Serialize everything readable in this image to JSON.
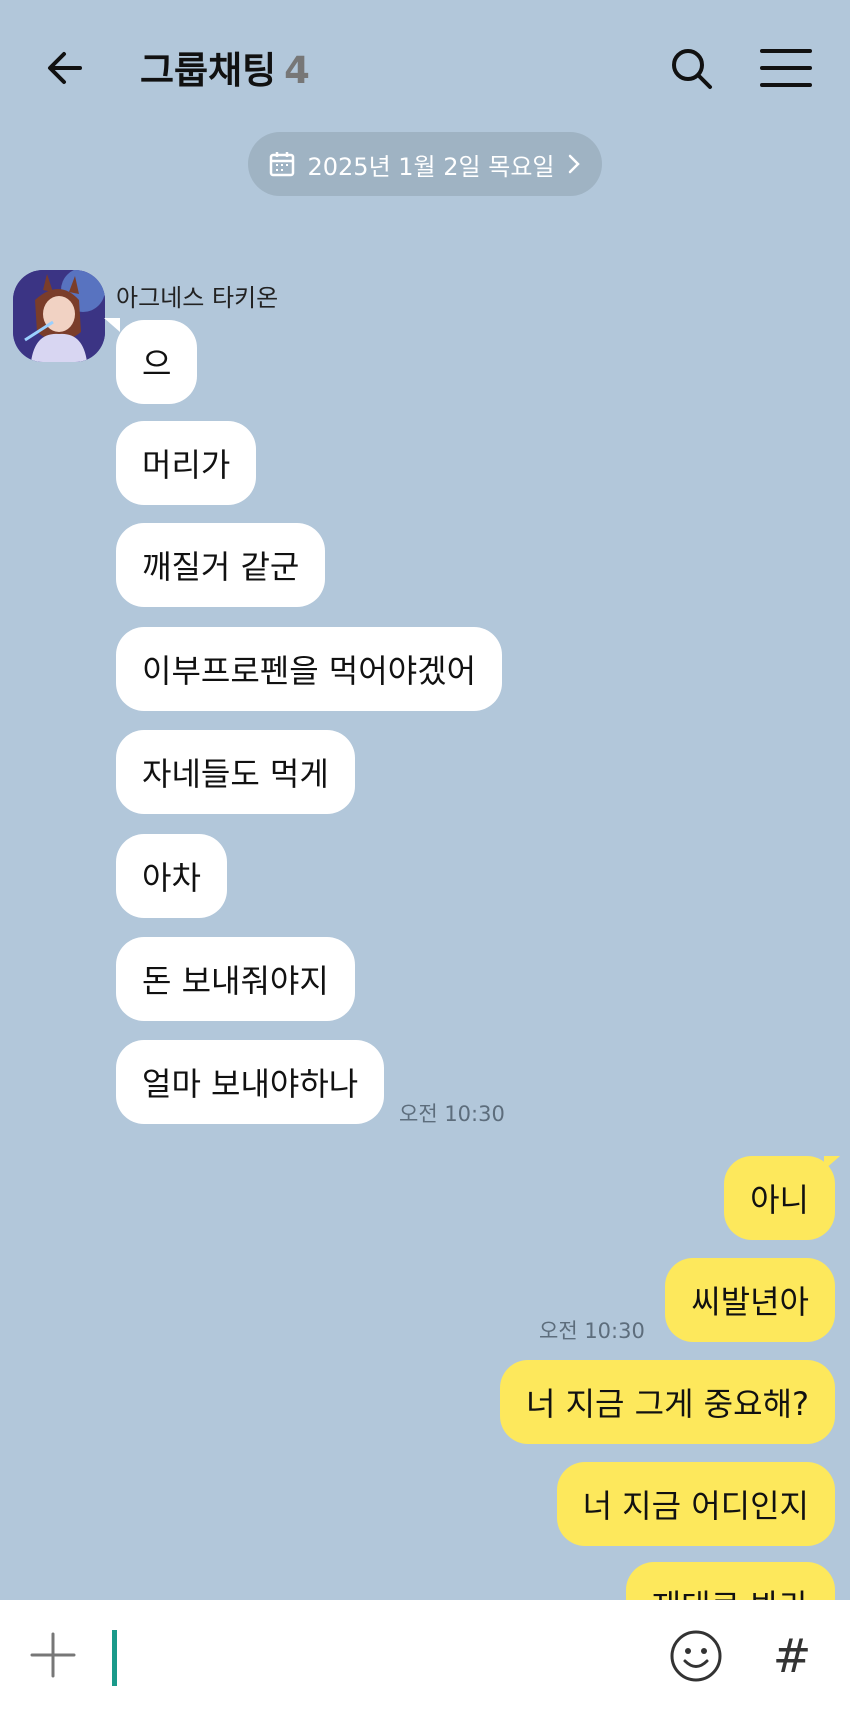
{
  "header": {
    "title": "그룹채팅",
    "member_count": "4"
  },
  "date_divider": {
    "label": "2025년 1월 2일 목요일"
  },
  "icons": {
    "back": "back-arrow-icon",
    "search": "search-icon",
    "menu": "hamburger-menu-icon",
    "calendar": "calendar-icon",
    "chevron": "chevron-right-icon",
    "plus": "plus-icon",
    "emoji": "emoji-icon",
    "hashtag": "hashtag-icon"
  },
  "colors": {
    "background": "#b2c7da",
    "incoming_bubble": "#ffffff",
    "outgoing_bubble": "#fde85c",
    "cursor": "#1a9a8a"
  },
  "incoming": {
    "sender": "아그네스 타키온",
    "messages": [
      "으",
      "머리가",
      "깨질거 같군",
      "이부프로펜을 먹어야겠어",
      "자네들도 먹게",
      "아차",
      "돈 보내줘야지",
      "얼마 보내야하나"
    ],
    "time": "오전 10:30"
  },
  "outgoing": {
    "messages": [
      "아니",
      "씨발년아",
      "너 지금 그게 중요해?",
      "너 지금 어디인지",
      "재대로 봐라"
    ],
    "time": "오전 10:30"
  },
  "input": {
    "value": "",
    "placeholder": ""
  },
  "hashtag_symbol": "#"
}
